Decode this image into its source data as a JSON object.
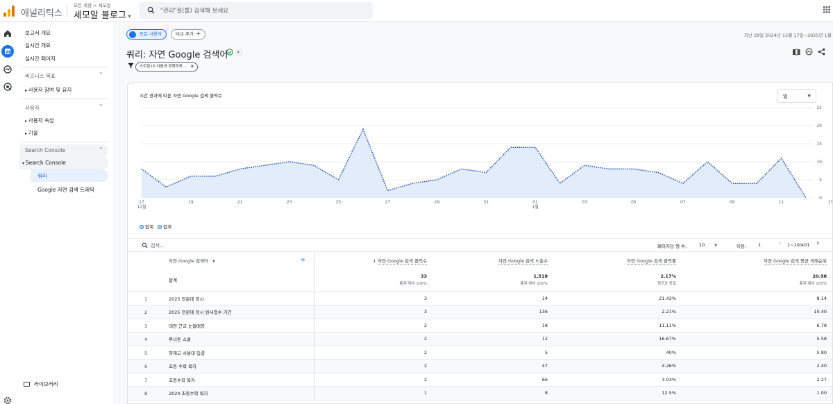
{
  "app": {
    "name": "애널리틱스",
    "account_path": "모든 계정 > 세모알",
    "property_name": "세모알 블로그",
    "search_placeholder": "\"관리\"을(를) 검색해 보세요"
  },
  "nav": {
    "items": [
      {
        "label": "보고서 개요"
      },
      {
        "label": "실시간 개요"
      },
      {
        "label": "실시간 페이지"
      }
    ],
    "section_business": "비즈니스 목표",
    "business_item": "사용자 참여 및 유지",
    "section_user": "사용자",
    "user_items": [
      "사용자 속성",
      "기술"
    ],
    "section_sc": "Search Console",
    "sc_group": "Search Console",
    "sc_items": [
      "쿼리",
      "Google 자연 검색 트래픽"
    ],
    "library": "라이브러리"
  },
  "header": {
    "segment_chip": "모든 사용자",
    "compare_chip": "비교 추가",
    "date_range": "지난 28일  2024년 12월 17일~2025년 1월",
    "title": "쿼리: 자연 Google 검색어",
    "filter_chip": "스트림 ID 다음과 정확하게 ..."
  },
  "card": {
    "chart_title": "시간 경과에 따른 자연 Google 검색 클릭수",
    "granularity": "일",
    "legend": [
      "합계",
      "합계"
    ]
  },
  "chart_data": {
    "type": "area",
    "title": "시간 경과에 따른 자연 Google 검색 클릭수",
    "x": [
      "12-17",
      "12-18",
      "12-19",
      "12-20",
      "12-21",
      "12-22",
      "12-23",
      "12-24",
      "12-25",
      "12-26",
      "12-27",
      "12-28",
      "12-29",
      "12-30",
      "12-31",
      "01-01",
      "01-02",
      "01-03",
      "01-04",
      "01-05",
      "01-06",
      "01-07",
      "01-08",
      "01-09",
      "01-10",
      "01-11",
      "01-12",
      "01-13"
    ],
    "x_tick_labels": [
      "17\n12월",
      "19",
      "21",
      "23",
      "25",
      "27",
      "29",
      "31",
      "01\n1월",
      "03",
      "05",
      "07",
      "09",
      "11",
      "13"
    ],
    "series": [
      {
        "name": "합계",
        "values": [
          8,
          3,
          6,
          6,
          8,
          9,
          10,
          9,
          5,
          19,
          2,
          4,
          5,
          8,
          7,
          14,
          14,
          4,
          9,
          8,
          8,
          7,
          4,
          10,
          4,
          4,
          11,
          0
        ]
      }
    ],
    "y_ticks": [
      0,
      5,
      10,
      15,
      20,
      25
    ],
    "ylim": [
      0,
      25
    ],
    "grid": true,
    "legend_position": "bottom-left",
    "colors": {
      "line": "#1a4ec2",
      "fill": "#e3ecfb"
    }
  },
  "table": {
    "search_placeholder": "검색...",
    "rows_per_page_label": "페이지당 행 수:",
    "rows_per_page": "10",
    "goto_label": "이동:",
    "goto_value": "1",
    "pagination": "1~10/401",
    "dim_header": "자연 Google 검색어",
    "col_headers": [
      "자연 Google 검색 클릭수",
      "자연 Google 검색 노출수",
      "자연 Google 검색 클릭률",
      "자연 Google 검색 평균 게재순위"
    ],
    "total_label": "합계",
    "totals": [
      {
        "value": "33",
        "sub": "총계 대비 100%"
      },
      {
        "value": "1,518",
        "sub": "총계 대비 100%"
      },
      {
        "value": "2.17%",
        "sub": "평균과 동일"
      },
      {
        "value": "20.98",
        "sub": "총계 대비 100%"
      }
    ],
    "rows": [
      {
        "idx": "1",
        "query": "2025 전문대 정시",
        "clicks": "3",
        "impr": "14",
        "ctr": "21.43%",
        "pos": "8.14"
      },
      {
        "idx": "2",
        "query": "2025 전문대 정시 원서접수 기간",
        "clicks": "3",
        "impr": "136",
        "ctr": "2.21%",
        "pos": "10.40"
      },
      {
        "idx": "3",
        "query": "대전 근교 눈썰매장",
        "clicks": "2",
        "impr": "18",
        "ctr": "11.11%",
        "pos": "6.78"
      },
      {
        "idx": "4",
        "query": "루너톤 스쿨",
        "clicks": "2",
        "impr": "12",
        "ctr": "16.67%",
        "pos": "5.58"
      },
      {
        "idx": "5",
        "query": "영재고 서울대 입결",
        "clicks": "2",
        "impr": "5",
        "ctr": "40%",
        "pos": "5.80"
      },
      {
        "idx": "6",
        "query": "초등 수학 목차",
        "clicks": "2",
        "impr": "47",
        "ctr": "4.26%",
        "pos": "2.40"
      },
      {
        "idx": "7",
        "query": "초등수학 목차",
        "clicks": "2",
        "impr": "66",
        "ctr": "3.03%",
        "pos": "2.27"
      },
      {
        "idx": "8",
        "query": "2024 초등수학 목차",
        "clicks": "1",
        "impr": "8",
        "ctr": "12.5%",
        "pos": "1.00"
      }
    ]
  }
}
